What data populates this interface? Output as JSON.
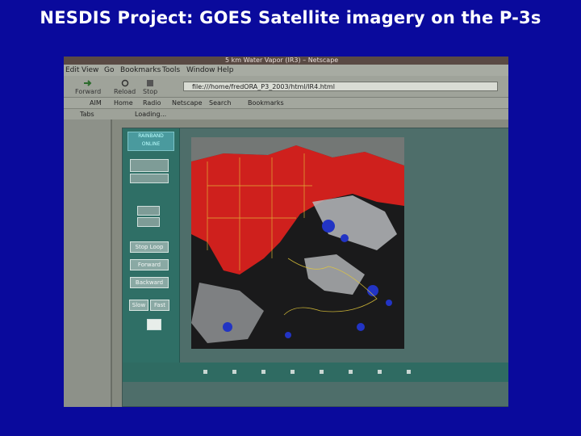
{
  "slide": {
    "title": "NESDIS Project: GOES Satellite imagery on the P-3s"
  },
  "browser": {
    "window_title": "5 km Water Vapor (IR3) – Netscape",
    "menu": [
      "Edit",
      "View",
      "Go",
      "Bookmarks",
      "Tools",
      "Window",
      "Help"
    ],
    "toolbar": {
      "forward_label": "Forward",
      "reload_label": "Reload",
      "stop_label": "Stop"
    },
    "url": "file:///home/fredORA_P3_2003/html/IR4.html",
    "personal_toolbar": [
      "AIM",
      "Home",
      "Radio",
      "Netscape",
      "Search",
      "Bookmarks"
    ],
    "tabs_label": "Tabs",
    "loading_label": "Loading..."
  },
  "page": {
    "header_button": "RAINBAND ONLINE",
    "buttons": {
      "stop_loop": "Stop Loop",
      "forward": "Forward",
      "backward": "Backward",
      "slow": "Slow",
      "fast": "Fast"
    }
  },
  "colors": {
    "slide_background": "#0a0a9c",
    "title_text": "#ffffff",
    "water_vapor_dry": "#e8211e",
    "water_vapor_moist": "#2234c4"
  }
}
